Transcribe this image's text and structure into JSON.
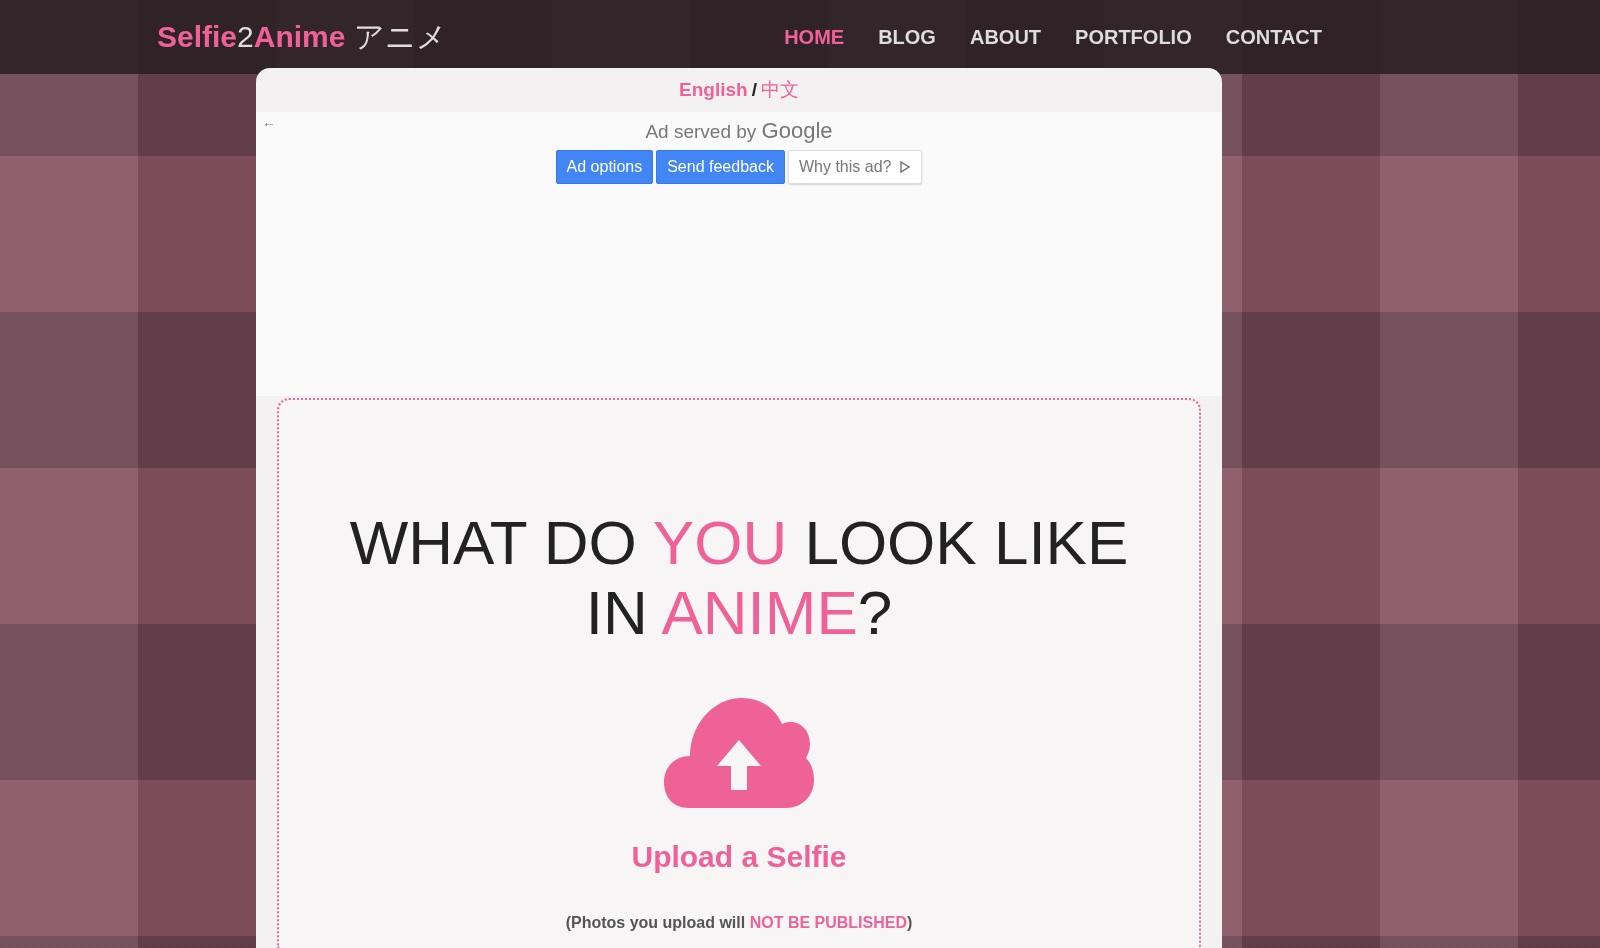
{
  "header": {
    "brand": [
      {
        "text": "Selfie",
        "accent": true
      },
      {
        "text": "2",
        "accent": false
      },
      {
        "text": "Anime",
        "accent": true
      },
      {
        "text": " アニメ",
        "accent": false
      }
    ],
    "nav": [
      {
        "label": "HOME",
        "selected": true
      },
      {
        "label": "BLOG",
        "selected": false
      },
      {
        "label": "ABOUT",
        "selected": false
      },
      {
        "label": "PORTFOLIO",
        "selected": false
      },
      {
        "label": "CONTACT",
        "selected": false
      }
    ]
  },
  "language": {
    "options": [
      {
        "label": "English",
        "selected": true
      },
      {
        "label": "中文",
        "selected": false
      }
    ],
    "separator": "/"
  },
  "ad": {
    "back": "←",
    "served_by": "Ad served by",
    "brand": "Google",
    "buttons": [
      {
        "label": "Ad options",
        "kind": "primary"
      },
      {
        "label": "Send feedback",
        "kind": "primary"
      },
      {
        "label": "Why this ad?",
        "kind": "plain"
      }
    ]
  },
  "hero": {
    "heading_lines": [
      [
        {
          "text": "WHAT DO ",
          "accent": false
        },
        {
          "text": "YOU",
          "accent": true
        },
        {
          "text": " LOOK LIKE",
          "accent": false
        }
      ],
      [
        {
          "text": "IN ",
          "accent": false
        },
        {
          "text": "ANIME",
          "accent": true
        },
        {
          "text": "?",
          "accent": false
        }
      ]
    ],
    "upload_label": "Upload a Selfie",
    "note": [
      {
        "text": "(Photos you upload will ",
        "accent": false
      },
      {
        "text": "NOT BE PUBLISHED",
        "accent": true
      },
      {
        "text": ")",
        "accent": false
      }
    ]
  }
}
